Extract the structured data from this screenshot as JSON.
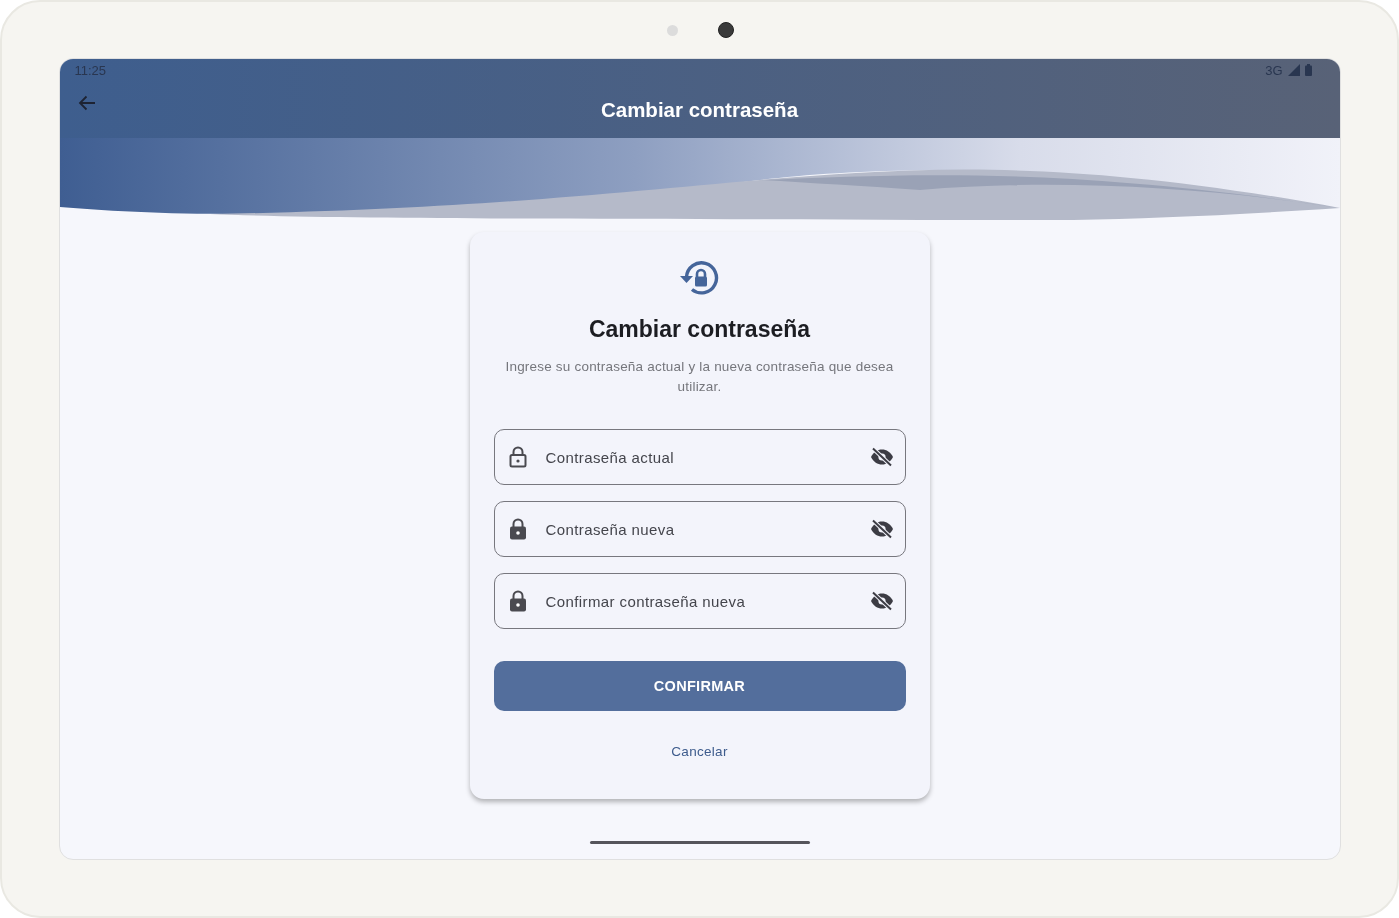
{
  "status_bar": {
    "time": "11:25",
    "network": "3G"
  },
  "app_bar": {
    "title": "Cambiar contraseña"
  },
  "card": {
    "title": "Cambiar contraseña",
    "description": "Ingrese su contraseña actual y la nueva contraseña que desea utilizar.",
    "fields": [
      {
        "placeholder": "Contraseña actual",
        "kind": "outline"
      },
      {
        "placeholder": "Contraseña nueva",
        "kind": "filled"
      },
      {
        "placeholder": "Confirmar contraseña nueva",
        "kind": "filled"
      }
    ],
    "confirm_button": "CONFIRMAR",
    "cancel_link": "Cancelar"
  }
}
